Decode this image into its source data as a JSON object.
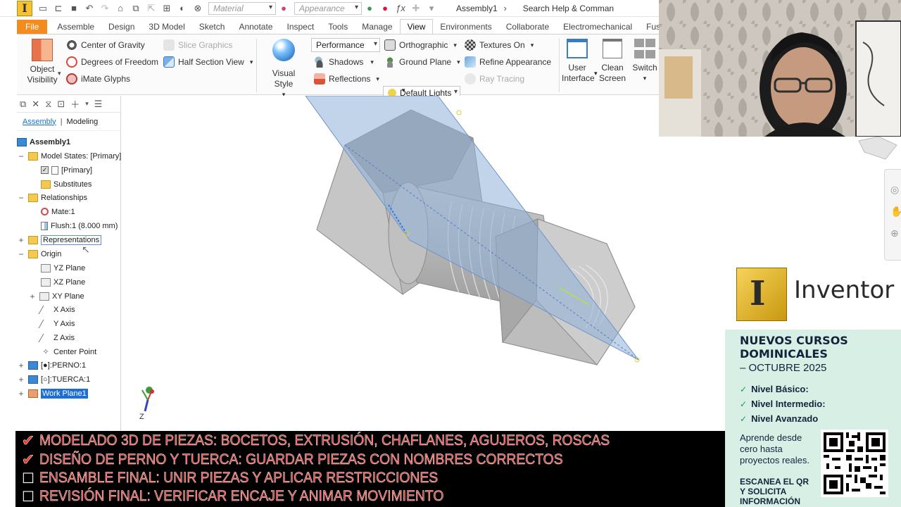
{
  "qat": {
    "material": "Material",
    "appearance": "Appearance",
    "title": "Assembly1",
    "search": "Search Help & Comman"
  },
  "tabs": [
    "File",
    "Assemble",
    "Design",
    "3D Model",
    "Sketch",
    "Annotate",
    "Inspect",
    "Tools",
    "Manage",
    "View",
    "Environments",
    "Collaborate",
    "Electromechanical",
    "Fusion"
  ],
  "ribbon": {
    "object_visibility": [
      "Object",
      "Visibility"
    ],
    "center_gravity": "Center of Gravity",
    "dof": "Degrees of Freedom",
    "imate": "iMate Glyphs",
    "slice": "Slice Graphics",
    "half_section": "Half Section View",
    "visual_style": "Visual Style",
    "performance": "Performance",
    "shadows": "Shadows",
    "reflections": "Reflections",
    "orthographic": "Orthographic",
    "ground_plane": "Ground Plane",
    "default_lights": "Default Lights",
    "textures": "Textures On",
    "refine": "Refine Appearance",
    "ray_tracing": "Ray Tracing",
    "user_interface": [
      "User",
      "Interface"
    ],
    "clean_screen": [
      "Clean",
      "Screen"
    ],
    "switch": "Switch"
  },
  "browser": {
    "mode_assembly": "Assembly",
    "mode_modeling": "Modeling",
    "nodes": [
      {
        "label": "Assembly1"
      },
      {
        "label": "Model States: [Primary]"
      },
      {
        "label": "[Primary]"
      },
      {
        "label": "Substitutes"
      },
      {
        "label": "Relationships"
      },
      {
        "label": "Mate:1"
      },
      {
        "label": "Flush:1 (8.000 mm)"
      },
      {
        "label": "Representations"
      },
      {
        "label": "Origin"
      },
      {
        "label": "YZ Plane"
      },
      {
        "label": "XZ Plane"
      },
      {
        "label": "XY Plane"
      },
      {
        "label": "X Axis"
      },
      {
        "label": "Y Axis"
      },
      {
        "label": "Z Axis"
      },
      {
        "label": "Center Point"
      },
      {
        "label": "[●]:PERNO:1"
      },
      {
        "label": "[○]:TUERCA:1"
      },
      {
        "label": "Work Plane1"
      }
    ]
  },
  "triad": {
    "z": "Z"
  },
  "promo": {
    "brand": "Inventor",
    "title1": "NUEVOS CURSOS",
    "title2": "DOMINICALES",
    "subtitle": "– OCTUBRE 2025",
    "levels": [
      "Nivel Básico:",
      "Nivel Intermedio:",
      "Nivel Avanzado"
    ],
    "text": [
      "Aprende desde",
      "cero hasta",
      "proyectos reales."
    ],
    "cta": [
      "ESCANEA EL QR",
      "Y SOLICITA",
      "INFORMACIÓN"
    ]
  },
  "banner": {
    "lines": [
      {
        "mark": "✔",
        "text": "MODELADO 3D DE PIEZAS: BOCETOS, EXTRUSIÓN, CHAFLANES, AGUJEROS, ROSCAS"
      },
      {
        "mark": "✔",
        "text": "DISEÑO DE PERNO Y TUERCA: GUARDAR PIEZAS CON NOMBRES CORRECTOS"
      },
      {
        "mark": "☐",
        "text": "ENSAMBLE FINAL: UNIR PIEZAS Y APLICAR RESTRICCIONES"
      },
      {
        "mark": "☐",
        "text": "REVISIÓN FINAL: VERIFICAR ENCAJE Y ANIMAR MOVIMIENTO"
      }
    ]
  },
  "colors": {
    "file_tab": "#f28c1e",
    "selection": "#1e6fd3",
    "banner_text": "#e8372c",
    "promo_bg": "#d8efe6",
    "logo_yellow": "#f4c233"
  }
}
